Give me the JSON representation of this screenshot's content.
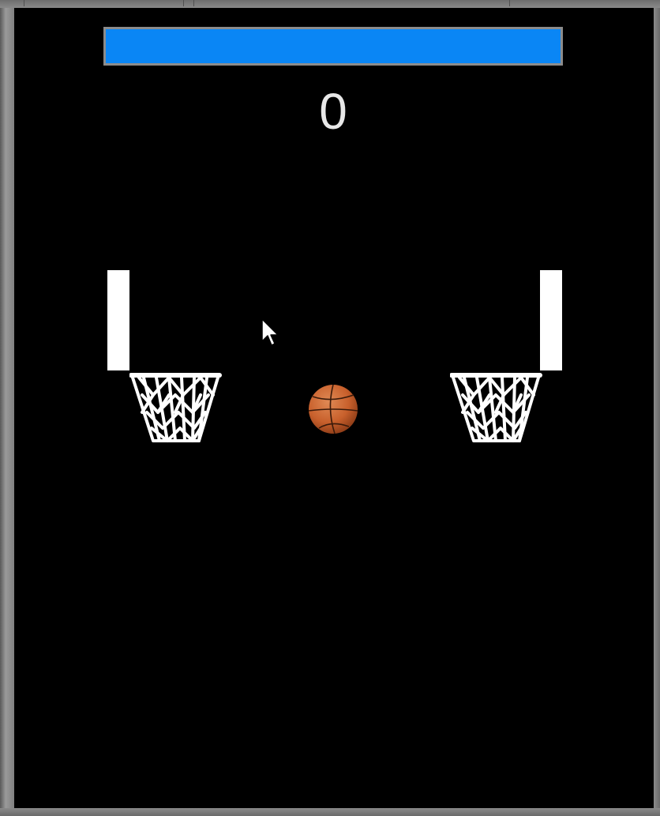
{
  "game": {
    "score": "0",
    "time_remaining_fraction": 1.0,
    "colors": {
      "background": "#000000",
      "time_bar": "#0a86f5",
      "time_bar_border": "#8c8c8c",
      "score_text": "#e8e8e8",
      "hoop": "#ffffff",
      "ball": "#c8602c"
    },
    "icons": {
      "ball": "basketball-icon",
      "cursor": "mouse-pointer-icon"
    }
  }
}
